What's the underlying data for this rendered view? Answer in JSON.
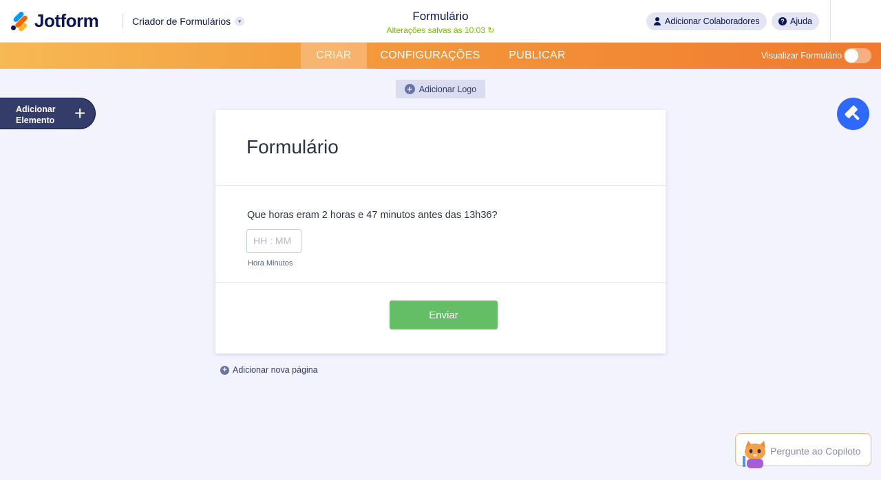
{
  "header": {
    "logo_text": "Jotform",
    "builder_title": "Criador de Formulários",
    "form_name": "Formulário",
    "save_status": "Alterações salvas às 10:03",
    "collaborators_button": "Adicionar Colaboradores",
    "help_button": "Ajuda"
  },
  "nav": {
    "tabs": [
      {
        "label": "CRIAR",
        "active": true
      },
      {
        "label": "CONFIGURAÇÕES",
        "active": false
      },
      {
        "label": "PUBLICAR",
        "active": false
      }
    ],
    "preview_label": "Visualizar Formulário",
    "preview_enabled": false
  },
  "sidebar": {
    "add_element_line1": "Adicionar",
    "add_element_line2": "Elemento"
  },
  "canvas": {
    "add_logo": "Adicionar Logo",
    "add_page": "Adicionar nova página"
  },
  "form": {
    "title": "Formulário",
    "question": "Que horas eram 2 horas e 47 minutos antes das 13h36?",
    "time_placeholder": "HH : MM",
    "time_sublabel": "Hora Minutos",
    "submit_label": "Enviar"
  },
  "copilot": {
    "label": "Pergunte ao Copiloto"
  },
  "colors": {
    "brand_navy": "#0a1551",
    "accent_orange": "#f07a2e",
    "submit_green": "#64be66",
    "design_blue": "#2e69ff",
    "saved_green": "#78bb07"
  },
  "icons": {
    "logo": "jotform-logo-icon",
    "chevron": "chevron-down-icon",
    "refresh": "refresh-icon",
    "person": "person-icon",
    "help": "question-icon",
    "plus": "plus-icon",
    "paint": "paint-roller-icon",
    "copilot": "copilot-cat-icon"
  }
}
